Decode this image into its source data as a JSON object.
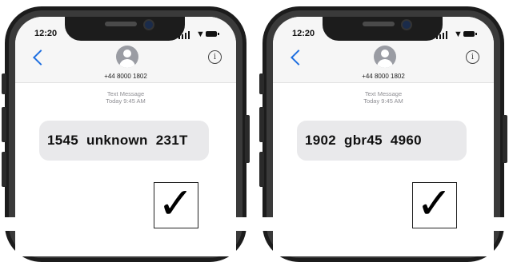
{
  "phones": [
    {
      "status_time": "12:20",
      "contact_number": "+44 8000 1802",
      "message_label": "Text Message",
      "message_time": "Today 9:45 AM",
      "message_text": "1545  unknown  231T",
      "checkmark": "✓"
    },
    {
      "status_time": "12:20",
      "contact_number": "+44 8000 1802",
      "message_label": "Text Message",
      "message_time": "Today 9:45 AM",
      "message_text": "1902  gbr45  4960",
      "checkmark": "✓"
    }
  ],
  "colors": {
    "accent": "#1f6fe0",
    "bubble": "#e9e9eb",
    "frame": "#1c1c1c"
  },
  "icons": [
    "back-icon",
    "avatar-icon",
    "info-icon",
    "signal-icon",
    "wifi-icon",
    "battery-icon",
    "checkmark-icon"
  ]
}
